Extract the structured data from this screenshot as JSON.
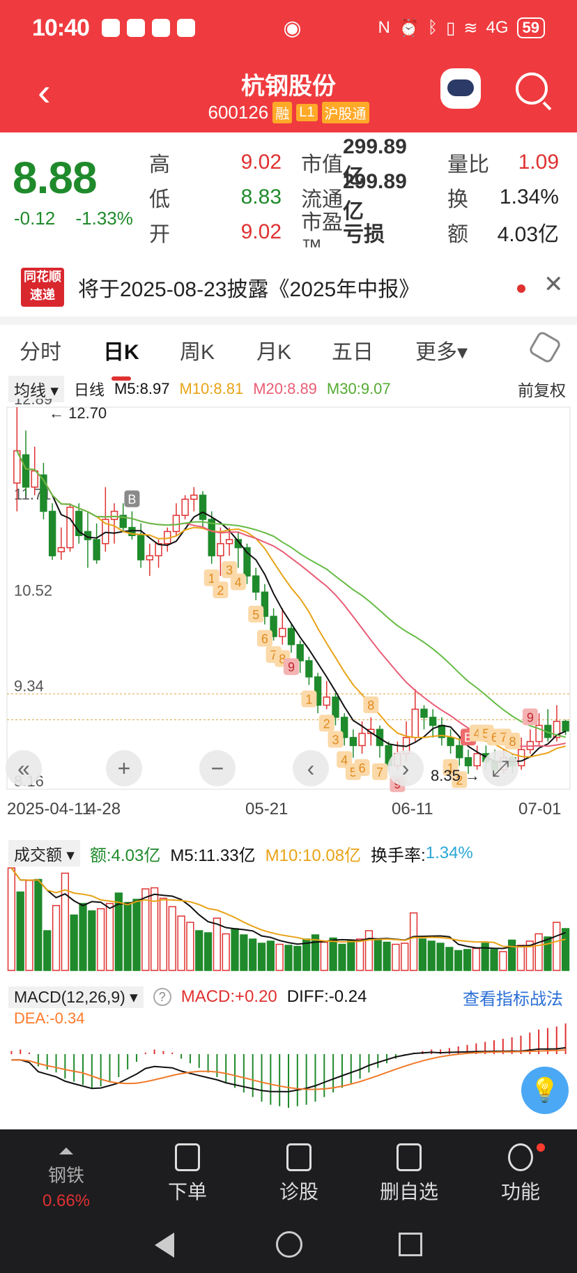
{
  "status": {
    "time": "10:40",
    "network": "4G",
    "battery": "59"
  },
  "header": {
    "stock_name": "杭钢股份",
    "code": "600126",
    "tags": [
      "融",
      "L1",
      "沪股通"
    ]
  },
  "quote": {
    "price": "8.88",
    "change": "-0.12",
    "change_pct": "-1.33%",
    "high_label": "高",
    "high": "9.02",
    "low_label": "低",
    "low": "8.83",
    "open_label": "开",
    "open": "9.02",
    "mktcap_label": "市值",
    "mktcap": "299.89亿",
    "float_label": "流通",
    "float": "299.89亿",
    "pe_label": "市盈™",
    "pe": "亏损",
    "vol_ratio_label": "量比",
    "vol_ratio": "1.09",
    "turnover_label": "换",
    "turnover": "1.34%",
    "amount_label": "额",
    "amount": "4.03亿"
  },
  "notice": {
    "logo_line1": "同花顺",
    "logo_line2": "速递",
    "text": "将于2025-08-23披露《2025年中报》",
    "close": "✕"
  },
  "tabs": [
    "分时",
    "日K",
    "周K",
    "月K",
    "五日",
    "更多▾"
  ],
  "ma_legend": {
    "chip": "均线 ▾",
    "period": "日线",
    "m5": "M5:8.97",
    "m10": "M10:8.81",
    "m20": "M20:8.89",
    "m30": "M30:9.07",
    "adjust": "前复权"
  },
  "colors": {
    "up": "#e03131",
    "down": "#1f8a2b",
    "m5": "#111111",
    "m10": "#e8a317",
    "m20": "#e85d75",
    "m30": "#66bb44"
  },
  "chart_data": [
    {
      "type": "candlestick",
      "y_labels": [
        "12.89",
        "11.71",
        "10.52",
        "9.34",
        "8.16"
      ],
      "x_labels": [
        "2025-04-11",
        "4-28",
        "05-21",
        "06-11",
        "07-01"
      ],
      "high_marker": "12.70",
      "low_marker": "8.35",
      "ylim": [
        8.16,
        12.89
      ],
      "candles": [
        [
          11.95,
          12.35,
          12.89,
          11.6
        ],
        [
          12.3,
          11.9,
          12.6,
          11.8
        ],
        [
          11.9,
          12.1,
          12.4,
          11.8
        ],
        [
          12.05,
          11.6,
          12.2,
          11.5
        ],
        [
          11.6,
          11.05,
          11.7,
          11.0
        ],
        [
          11.1,
          11.15,
          11.4,
          11.0
        ],
        [
          11.15,
          11.65,
          11.7,
          11.1
        ],
        [
          11.6,
          11.3,
          11.7,
          11.2
        ],
        [
          11.35,
          11.25,
          11.6,
          10.9
        ],
        [
          11.25,
          11.0,
          11.45,
          10.95
        ],
        [
          11.2,
          11.5,
          11.9,
          11.1
        ],
        [
          11.5,
          11.6,
          11.7,
          11.2
        ],
        [
          11.55,
          11.4,
          11.7,
          11.35
        ],
        [
          11.4,
          11.3,
          11.6,
          11.25
        ],
        [
          11.3,
          11.0,
          11.45,
          10.9
        ],
        [
          11.0,
          11.05,
          11.2,
          10.8
        ],
        [
          11.05,
          11.2,
          11.25,
          10.9
        ],
        [
          11.2,
          11.35,
          11.4,
          11.1
        ],
        [
          11.35,
          11.55,
          11.7,
          11.3
        ],
        [
          11.55,
          11.75,
          11.8,
          11.5
        ],
        [
          11.75,
          11.8,
          11.9,
          11.6
        ],
        [
          11.8,
          11.5,
          11.85,
          11.4
        ],
        [
          11.5,
          11.05,
          11.6,
          10.95
        ],
        [
          11.05,
          11.2,
          11.4,
          10.8
        ],
        [
          11.2,
          11.25,
          11.4,
          11.05
        ],
        [
          11.25,
          11.15,
          11.35,
          10.9
        ],
        [
          11.15,
          10.8,
          11.2,
          10.7
        ],
        [
          10.8,
          10.6,
          10.9,
          10.5
        ],
        [
          10.6,
          10.3,
          10.7,
          10.2
        ],
        [
          10.3,
          10.05,
          10.4,
          10.0
        ],
        [
          10.05,
          10.15,
          10.4,
          9.95
        ],
        [
          10.15,
          9.95,
          10.2,
          9.85
        ],
        [
          9.95,
          9.75,
          10.0,
          9.6
        ],
        [
          9.75,
          9.55,
          9.8,
          9.45
        ],
        [
          9.55,
          9.2,
          9.6,
          9.1
        ],
        [
          9.2,
          9.3,
          9.5,
          9.15
        ],
        [
          9.3,
          9.05,
          9.35,
          8.95
        ],
        [
          9.05,
          8.8,
          9.1,
          8.7
        ],
        [
          8.8,
          8.7,
          8.9,
          8.55
        ],
        [
          8.7,
          8.85,
          9.0,
          8.6
        ],
        [
          8.85,
          8.9,
          9.05,
          8.7
        ],
        [
          8.9,
          8.7,
          8.95,
          8.55
        ],
        [
          8.7,
          8.45,
          8.75,
          8.4
        ],
        [
          8.45,
          8.6,
          8.75,
          8.4
        ],
        [
          8.6,
          8.8,
          9.0,
          8.5
        ],
        [
          8.8,
          9.15,
          9.4,
          8.75
        ],
        [
          9.15,
          9.05,
          9.2,
          8.9
        ],
        [
          9.05,
          8.95,
          9.15,
          8.8
        ],
        [
          8.95,
          8.8,
          9.05,
          8.7
        ],
        [
          8.8,
          8.7,
          8.9,
          8.6
        ],
        [
          8.7,
          8.55,
          8.8,
          8.45
        ],
        [
          8.55,
          8.45,
          8.65,
          8.35
        ],
        [
          8.45,
          8.6,
          8.7,
          8.4
        ],
        [
          8.6,
          8.5,
          8.7,
          8.4
        ],
        [
          8.5,
          8.4,
          8.65,
          8.35
        ],
        [
          8.4,
          8.55,
          8.65,
          8.35
        ],
        [
          8.55,
          8.45,
          8.6,
          8.35
        ],
        [
          8.45,
          8.65,
          8.8,
          8.4
        ],
        [
          8.65,
          8.75,
          8.9,
          8.6
        ],
        [
          8.75,
          8.95,
          9.1,
          8.7
        ],
        [
          8.95,
          8.8,
          9.15,
          8.75
        ],
        [
          8.8,
          9.0,
          9.2,
          8.75
        ],
        [
          9.0,
          8.88,
          9.02,
          8.83
        ]
      ],
      "markers": [
        {
          "i": 22,
          "label": "1",
          "side": "below"
        },
        {
          "i": 23,
          "label": "2",
          "side": "below"
        },
        {
          "i": 24,
          "label": "3",
          "side": "below"
        },
        {
          "i": 25,
          "label": "4",
          "side": "below"
        },
        {
          "i": 27,
          "label": "5",
          "side": "below"
        },
        {
          "i": 28,
          "label": "6",
          "side": "below"
        },
        {
          "i": 29,
          "label": "7",
          "side": "below"
        },
        {
          "i": 30,
          "label": "8",
          "side": "below"
        },
        {
          "i": 31,
          "label": "9",
          "side": "below"
        },
        {
          "i": 33,
          "label": "1",
          "side": "below"
        },
        {
          "i": 35,
          "label": "2",
          "side": "below"
        },
        {
          "i": 36,
          "label": "3",
          "side": "below"
        },
        {
          "i": 37,
          "label": "4",
          "side": "below"
        },
        {
          "i": 38,
          "label": "5",
          "side": "below"
        },
        {
          "i": 39,
          "label": "6",
          "side": "below"
        },
        {
          "i": 41,
          "label": "7",
          "side": "below"
        },
        {
          "i": 43,
          "label": "9",
          "side": "below"
        },
        {
          "i": 40,
          "label": "8",
          "side": "above"
        },
        {
          "i": 49,
          "label": "1",
          "side": "below"
        },
        {
          "i": 50,
          "label": "2",
          "side": "below"
        },
        {
          "i": 51,
          "label": "B",
          "side": "above"
        },
        {
          "i": 52,
          "label": "4",
          "side": "above"
        },
        {
          "i": 53,
          "label": "5",
          "side": "above"
        },
        {
          "i": 54,
          "label": "6",
          "side": "above"
        },
        {
          "i": 55,
          "label": "7",
          "side": "above"
        },
        {
          "i": 56,
          "label": "8",
          "side": "above"
        },
        {
          "i": 58,
          "label": "9",
          "side": "above"
        },
        {
          "i": 13,
          "label": "B",
          "side": "above"
        }
      ],
      "ref_lines": [
        9.34,
        9.02
      ]
    },
    {
      "type": "bar",
      "series_label": "成交额",
      "values": [
        9.8,
        7.5,
        8.6,
        8.7,
        3.8,
        6.2,
        9.3,
        5.3,
        6.4,
        5.7,
        5.9,
        6.4,
        7.4,
        6.5,
        6.8,
        7.8,
        7.9,
        6.9,
        6.1,
        5.2,
        4.6,
        3.8,
        3.6,
        5.0,
        3.5,
        4.0,
        3.4,
        3.0,
        2.6,
        2.8,
        2.5,
        2.4,
        2.3,
        3.0,
        3.4,
        2.7,
        3.1,
        2.5,
        2.9,
        3.0,
        3.8,
        2.9,
        2.7,
        2.5,
        2.6,
        5.5,
        3.0,
        2.8,
        2.6,
        2.2,
        1.9,
        2.0,
        2.1,
        2.6,
        2.0,
        1.8,
        2.9,
        2.4,
        2.8,
        3.5,
        3.2,
        4.6,
        4.0
      ],
      "ylim": [
        0,
        10
      ]
    },
    {
      "type": "bar",
      "series_label": "MACD",
      "values": [
        0.02,
        0.03,
        0.01,
        -0.08,
        -0.1,
        -0.12,
        -0.16,
        -0.18,
        -0.2,
        -0.22,
        -0.21,
        -0.18,
        -0.15,
        -0.1,
        -0.05,
        0.01,
        0.03,
        0.02,
        0.01,
        -0.03,
        -0.06,
        -0.09,
        -0.12,
        -0.15,
        -0.19,
        -0.22,
        -0.25,
        -0.28,
        -0.31,
        -0.33,
        -0.34,
        -0.35,
        -0.34,
        -0.33,
        -0.31,
        -0.28,
        -0.25,
        -0.22,
        -0.19,
        -0.16,
        -0.12,
        -0.09,
        -0.06,
        -0.03,
        -0.01,
        0.01,
        0.02,
        0.03,
        0.03,
        0.04,
        0.05,
        0.06,
        0.07,
        0.08,
        0.09,
        0.1,
        0.11,
        0.12,
        0.14,
        0.16,
        0.17,
        0.18,
        0.2
      ],
      "ylim": [
        -0.4,
        0.3
      ]
    }
  ],
  "volume_legend": {
    "chip": "成交额 ▾",
    "amount": "额:4.03亿",
    "m5": "M5:11.33亿",
    "m10": "M10:10.08亿",
    "turnover_label": "换手率:",
    "turnover": "1.34%"
  },
  "macd_legend": {
    "chip": "MACD(12,26,9) ▾",
    "help": "?",
    "macd": "MACD:+0.20",
    "diff": "DIFF:-0.24",
    "dea": "DEA:-0.34",
    "link": "查看指标战法"
  },
  "bottom_nav": [
    {
      "label": "钢铁",
      "pct": "0.66%"
    },
    {
      "label": "下单"
    },
    {
      "label": "诊股"
    },
    {
      "label": "删自选"
    },
    {
      "label": "功能"
    }
  ]
}
